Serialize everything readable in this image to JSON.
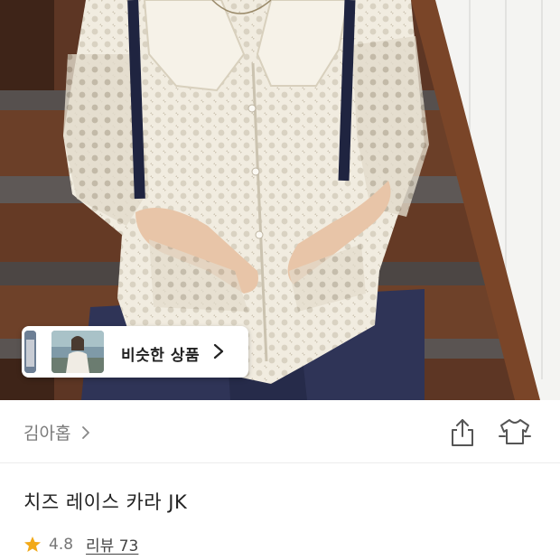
{
  "photo": {
    "subject": "woman-in-lace-jacket",
    "palette": {
      "stairs_wood": "#6b3f28",
      "stair_tread": "#5b5553",
      "wall": "#f4f4f2",
      "jacket": "#f1ece0",
      "pants": "#2f3457",
      "strap": "#1f2440",
      "skin": "#e8c5a8"
    }
  },
  "similar_chip": {
    "label": "비슷한 상품",
    "icon": "chevron-right-icon"
  },
  "brand": {
    "name": "김아홉",
    "icon": "chevron-right-icon"
  },
  "actions": {
    "share_icon": "share-icon",
    "wear_icon": "tshirt-icon"
  },
  "product": {
    "title": "치즈 레이스 카라 JK",
    "rating": "4.8",
    "review_label": "리뷰 73",
    "star_color": "#f2a918"
  }
}
